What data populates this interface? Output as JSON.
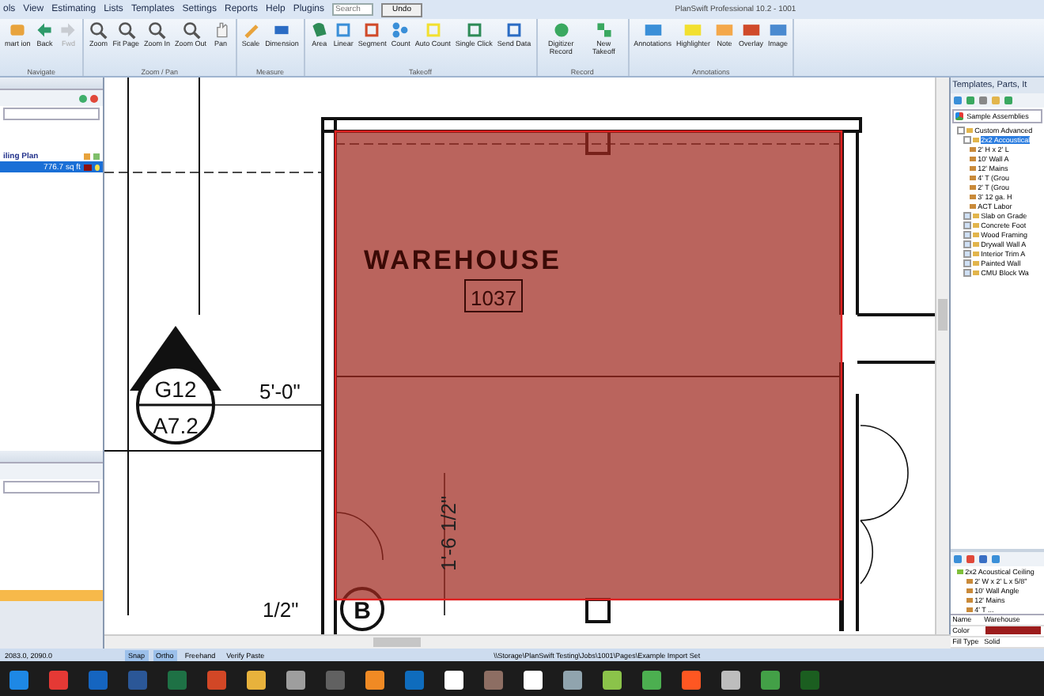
{
  "window": {
    "title": "PlanSwift Professional 10.2 - 1001"
  },
  "menu": [
    "ols",
    "View",
    "Estimating",
    "Lists",
    "Templates",
    "Settings",
    "Reports",
    "Help",
    "Plugins"
  ],
  "search": {
    "placeholder": "Search"
  },
  "undo_button": "Undo",
  "ribbon": [
    {
      "label": "Navigate",
      "buttons": [
        {
          "label": "mart ion",
          "disabled": false
        },
        {
          "label": "Back",
          "disabled": false
        },
        {
          "label": "Fwd",
          "disabled": true
        }
      ]
    },
    {
      "label": "Zoom / Pan",
      "buttons": [
        {
          "label": "Zoom",
          "disabled": false
        },
        {
          "label": "Fit Page",
          "disabled": false
        },
        {
          "label": "Zoom In",
          "disabled": false
        },
        {
          "label": "Zoom Out",
          "disabled": false
        },
        {
          "label": "Pan",
          "disabled": false
        }
      ]
    },
    {
      "label": "Measure",
      "buttons": [
        {
          "label": "Scale",
          "disabled": false
        },
        {
          "label": "Dimension",
          "disabled": false
        }
      ]
    },
    {
      "label": "Takeoff",
      "buttons": [
        {
          "label": "Area",
          "disabled": false
        },
        {
          "label": "Linear",
          "disabled": false
        },
        {
          "label": "Segment",
          "disabled": false
        },
        {
          "label": "Count",
          "disabled": false
        },
        {
          "label": "Auto Count",
          "disabled": false
        },
        {
          "label": "Single Click",
          "disabled": false
        },
        {
          "label": "Send Data",
          "disabled": false
        }
      ]
    },
    {
      "label": "Record",
      "buttons": [
        {
          "label": "Digitizer Record",
          "disabled": false
        },
        {
          "label": "New Takeoff",
          "disabled": false
        }
      ]
    },
    {
      "label": "Annotations",
      "buttons": [
        {
          "label": "Annotations",
          "disabled": false
        },
        {
          "label": "Highlighter",
          "disabled": false
        },
        {
          "label": "Note",
          "disabled": false
        },
        {
          "label": "Overlay",
          "disabled": false
        },
        {
          "label": "Image",
          "disabled": false
        }
      ]
    }
  ],
  "left_panel": {
    "takeoff": {
      "name": "iling Plan",
      "quantity": "776.7 sq ft",
      "selected": true
    }
  },
  "drawing": {
    "room_name": "WAREHOUSE",
    "room_number": "1037",
    "section_number": "G12",
    "section_sheet": "A7.2",
    "dimension_1": "5'-0\"",
    "dimension_2": "1'-6 1/2\"",
    "grid_bubble": "B",
    "dimension_3": "1/2\""
  },
  "right_panel": {
    "title": "Templates, Parts, It",
    "dropdown": "Sample Assemblies",
    "tree": [
      {
        "label": "Custom Advanced",
        "expanded": true,
        "selected": false,
        "children": [
          {
            "label": "2x2 Accoustical",
            "expanded": true,
            "selected": true,
            "children": [
              {
                "label": "2' H x 2' L",
                "selected": false
              },
              {
                "label": "10' Wall A",
                "selected": false
              },
              {
                "label": "12' Mains",
                "selected": false
              },
              {
                "label": "4' T (Grou",
                "selected": false
              },
              {
                "label": "2' T (Grou",
                "selected": false
              },
              {
                "label": "3' 12 ga. H",
                "selected": false
              },
              {
                "label": "ACT Labor",
                "selected": false
              }
            ]
          },
          {
            "label": "Slab on Grade",
            "expanded": false,
            "selected": false
          },
          {
            "label": "Concrete Foot",
            "expanded": false,
            "selected": false
          },
          {
            "label": "Wood Framing",
            "expanded": false,
            "selected": false
          },
          {
            "label": "Drywall Wall A",
            "expanded": false,
            "selected": false
          },
          {
            "label": "Interior Trim A",
            "expanded": false,
            "selected": false
          },
          {
            "label": "Painted Wall",
            "expanded": false,
            "selected": false
          },
          {
            "label": "CMU Block Wa",
            "expanded": false,
            "selected": false
          }
        ]
      }
    ],
    "lower_tree": {
      "label": "2x2 Acoustical Ceiling",
      "children": [
        "2' W x 2' L x 5/8\"",
        "10' Wall Angle",
        "12' Mains",
        "4' T ..."
      ]
    },
    "properties": [
      {
        "kind": "text",
        "name": "Name",
        "value": "Warehouse"
      },
      {
        "kind": "color",
        "name": "Color",
        "color": "#9c1c1c"
      },
      {
        "kind": "text",
        "name": "Fill Type",
        "value": "Solid"
      }
    ]
  },
  "status_bar": {
    "coordinates": "2083.0, 2090.0",
    "toggles": [
      {
        "label": "Snap",
        "on": true
      },
      {
        "label": "Ortho",
        "on": true
      },
      {
        "label": "Freehand",
        "on": false
      },
      {
        "label": "Verify Paste",
        "on": false
      }
    ],
    "path": "\\\\Storage\\PlanSwift Testing\\Jobs\\1001\\Pages\\Example Import Set"
  }
}
